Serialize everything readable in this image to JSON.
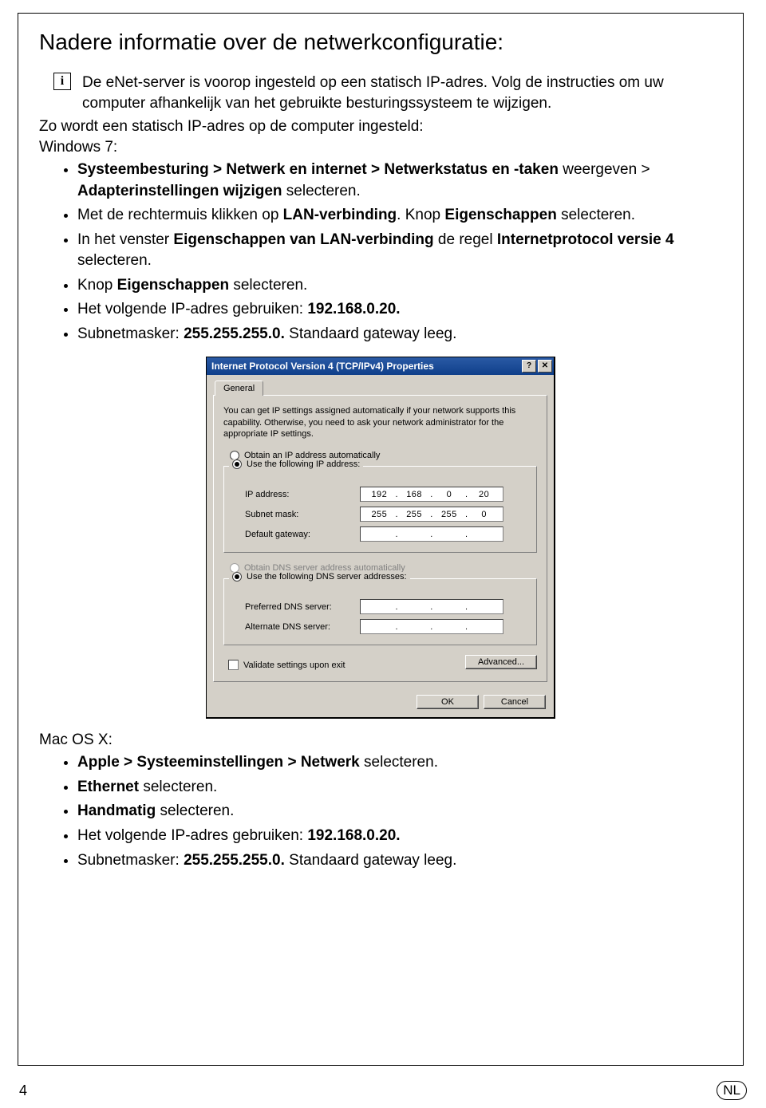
{
  "title": "Nadere informatie over de netwerkconfiguratie:",
  "info_icon": "i",
  "info_text": "De eNet-server is voorop ingesteld op een statisch IP-adres. Volg de instructies om uw computer afhankelijk van het gebruikte besturingssysteem te wijzigen.",
  "intro": "Zo wordt een statisch IP-adres op de computer ingesteld:",
  "win": {
    "heading": "Windows 7:",
    "items": [
      "<b>Systeembesturing > Netwerk en internet > Netwerkstatus en -taken</b> weergeven > <b>Adapterinstellingen wijzigen</b> selecteren.",
      "Met de rechtermuis klikken op <b>LAN-verbinding</b>. Knop <b>Eigenschappen</b> selecteren.",
      "In het venster <b>Eigenschappen van LAN-verbinding</b> de regel <b>Internetprotocol versie 4</b> selecteren.",
      "Knop <b>Eigenschappen</b> selecteren.",
      "Het volgende IP-adres gebruiken: <b>192.168.0.20.</b>",
      "Subnetmasker: <b>255.255.255.0.</b> Standaard gateway leeg."
    ]
  },
  "dialog": {
    "title": "Internet Protocol Version 4 (TCP/IPv4) Properties",
    "tab": "General",
    "desc": "You can get IP settings assigned automatically if your network supports this capability. Otherwise, you need to ask your network administrator for the appropriate IP settings.",
    "r_auto_ip": "Obtain an IP address automatically",
    "r_use_ip": "Use the following IP address:",
    "lbl_ip": "IP address:",
    "lbl_subnet": "Subnet mask:",
    "lbl_gateway": "Default gateway:",
    "ip_octets": [
      "192",
      "168",
      "0",
      "20"
    ],
    "subnet_octets": [
      "255",
      "255",
      "255",
      "0"
    ],
    "gateway_octets": [
      "",
      "",
      "",
      ""
    ],
    "r_auto_dns": "Obtain DNS server address automatically",
    "r_use_dns": "Use the following DNS server addresses:",
    "lbl_pref_dns": "Preferred DNS server:",
    "lbl_alt_dns": "Alternate DNS server:",
    "pref_dns_octets": [
      "",
      "",
      "",
      ""
    ],
    "alt_dns_octets": [
      "",
      "",
      "",
      ""
    ],
    "chk_validate": "Validate settings upon exit",
    "btn_advanced": "Advanced...",
    "btn_ok": "OK",
    "btn_cancel": "Cancel",
    "btn_help": "?",
    "btn_close": "✕"
  },
  "mac": {
    "heading": "Mac OS X:",
    "items": [
      "<b>Apple > Systeeminstellingen > Netwerk</b> selecteren.",
      "<b>Ethernet</b> selecteren.",
      "<b>Handmatig</b> selecteren.",
      "Het volgende IP-adres gebruiken: <b>192.168.0.20.</b>",
      "Subnetmasker: <b>255.255.255.0.</b> Standaard gateway leeg."
    ]
  },
  "footer": {
    "page": "4",
    "lang": "NL"
  }
}
